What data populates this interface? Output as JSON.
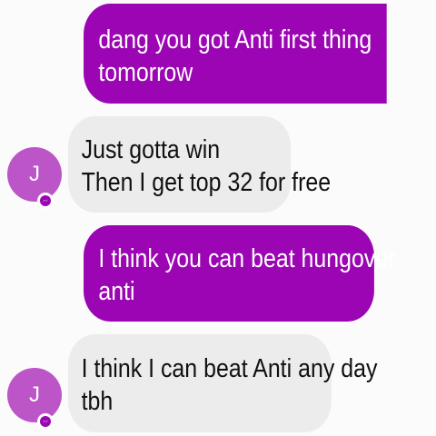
{
  "conversation": {
    "messages": [
      {
        "direction": "sent",
        "lines": [
          "dang you got Anti first thing",
          "tomorrow"
        ]
      },
      {
        "direction": "received",
        "avatar_initial": "J",
        "lines": [
          "Just gotta win",
          "Then I get top 32 for free"
        ]
      },
      {
        "direction": "sent",
        "lines": [
          "I think you can beat hungover",
          "anti"
        ]
      },
      {
        "direction": "received",
        "avatar_initial": "J",
        "lines": [
          "I think I can beat Anti any day",
          "tbh"
        ]
      }
    ]
  },
  "colors": {
    "sent_bubble": "#9b05b3",
    "received_bubble": "#ececec",
    "avatar": "#bb55c8",
    "badge_icon": "#9b05b3"
  },
  "icons": {
    "badge": "messenger-badge-icon"
  }
}
